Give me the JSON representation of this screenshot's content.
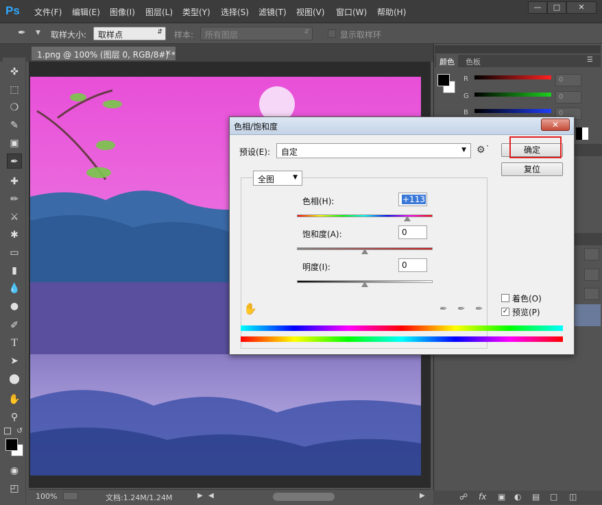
{
  "app": {
    "logo": "Ps",
    "menu": [
      "文件(F)",
      "编辑(E)",
      "图像(I)",
      "图层(L)",
      "类型(Y)",
      "选择(S)",
      "滤镜(T)",
      "视图(V)",
      "窗口(W)",
      "帮助(H)"
    ]
  },
  "options": {
    "sample_size_label": "取样大小:",
    "sample_size_value": "取样点",
    "sample_label": "样本:",
    "sample_value": "所有图层",
    "show_ring_label": "显示取样环"
  },
  "document": {
    "tab_title": "1.png @ 100% (图层 0, RGB/8#) *",
    "tab_close": "×"
  },
  "status": {
    "zoom": "100%",
    "doc_info": "文档:1.24M/1.24M"
  },
  "color_panel": {
    "tabs": [
      "颜色",
      "色板"
    ],
    "channels": [
      {
        "label": "R",
        "value": "0",
        "color": "#ff2020"
      },
      {
        "label": "G",
        "value": "0",
        "color": "#20d020"
      },
      {
        "label": "B",
        "value": "0",
        "color": "#2040ff"
      }
    ]
  },
  "dialog": {
    "title": "色相/饱和度",
    "close": "✕",
    "preset_label": "预设(E):",
    "preset_value": "自定",
    "ok_label": "确定",
    "reset_label": "复位",
    "range_value": "全图",
    "hue": {
      "label": "色相(H):",
      "value": "+113",
      "position": 113,
      "min": -180,
      "max": 180
    },
    "saturation": {
      "label": "饱和度(A):",
      "value": "0",
      "position": 0,
      "min": -100,
      "max": 100
    },
    "lightness": {
      "label": "明度(I):",
      "value": "0",
      "position": 0,
      "min": -100,
      "max": 100
    },
    "colorize_label": "着色(O)",
    "colorize_checked": false,
    "preview_label": "预览(P)",
    "preview_checked": true,
    "highlight_color": "#e02020"
  }
}
